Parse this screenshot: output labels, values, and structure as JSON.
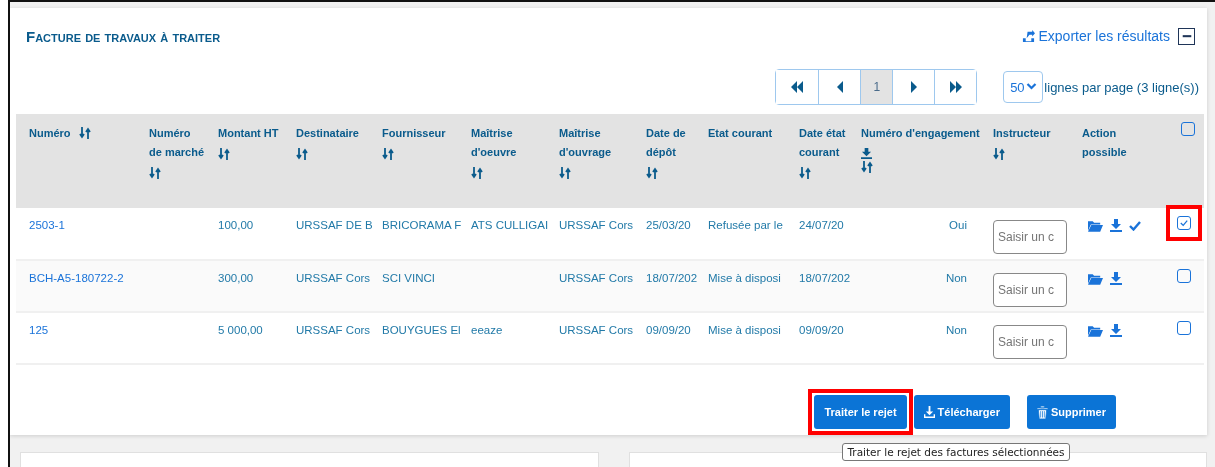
{
  "panel": {
    "title": "Facture de travaux à traiter",
    "export_label": "Exporter les résultats"
  },
  "pagination": {
    "pages": [
      {
        "kind": "first",
        "selected": false
      },
      {
        "kind": "prev",
        "selected": false
      },
      {
        "kind": "page",
        "label": "1",
        "selected": true
      },
      {
        "kind": "next",
        "selected": false
      },
      {
        "kind": "last",
        "selected": false
      }
    ],
    "page_size": "50",
    "page_size_label": "lignes par page (3 ligne(s))"
  },
  "table": {
    "columns": [
      {
        "label": "Numéro",
        "sortable": true,
        "download_icon": false
      },
      {
        "label": "Numéro de marché",
        "sortable": true,
        "download_icon": false
      },
      {
        "label": "Montant HT",
        "sortable": true,
        "download_icon": false
      },
      {
        "label": "Destinataire",
        "sortable": true,
        "download_icon": false
      },
      {
        "label": "Fournisseur",
        "sortable": true,
        "download_icon": false
      },
      {
        "label": "Maîtrise d'oeuvre",
        "sortable": true,
        "download_icon": false
      },
      {
        "label": "Maîtrise d'ouvrage",
        "sortable": true,
        "download_icon": false
      },
      {
        "label": "Date de dépôt",
        "sortable": true,
        "download_icon": false
      },
      {
        "label": "Etat courant",
        "sortable": false,
        "download_icon": false
      },
      {
        "label": "Date état courant",
        "sortable": true,
        "download_icon": false
      },
      {
        "label": "Numéro d'engagement",
        "sortable": true,
        "download_icon": true
      },
      {
        "label": "Instructeur",
        "sortable": true,
        "download_icon": false
      },
      {
        "label": "Action possible",
        "sortable": false,
        "download_icon": false
      }
    ],
    "all_checked": false,
    "rows": [
      {
        "cells": [
          "2503-1",
          "",
          "100,00",
          "URSSAF DE B",
          "BRICORAMA F",
          "ATS CULLIGAI",
          "URSSAF Cors",
          "25/03/20",
          "Refusée par le",
          "24/07/20",
          "Oui"
        ],
        "instructeur_placeholder": "Saisir un c",
        "actions": [
          {
            "kind": "folder"
          },
          {
            "kind": "download"
          },
          {
            "kind": "check"
          }
        ],
        "checked": true,
        "highlighted": true
      },
      {
        "cells": [
          "BCH-A5-180722-2",
          "",
          "300,00",
          "URSSAF Cors",
          "SCI VINCI",
          "",
          "URSSAF Cors",
          "18/07/202",
          "Mise à disposi",
          "18/07/202",
          "Non"
        ],
        "instructeur_placeholder": "Saisir un c",
        "actions": [
          {
            "kind": "folder"
          },
          {
            "kind": "download"
          }
        ],
        "checked": false,
        "highlighted": false
      },
      {
        "cells": [
          "125",
          "",
          "5 000,00",
          "URSSAF Cors",
          "BOUYGUES El",
          "eeaze",
          "URSSAF Cors",
          "09/09/20",
          "Mise à disposi",
          "09/09/20",
          "Non"
        ],
        "instructeur_placeholder": "Saisir un c",
        "actions": [
          {
            "kind": "folder"
          },
          {
            "kind": "download"
          }
        ],
        "checked": false,
        "highlighted": false
      }
    ]
  },
  "buttons": [
    {
      "kind": "reject",
      "label": "Traiter le rejet",
      "highlighted": true
    },
    {
      "kind": "download",
      "label": "Télécharger",
      "highlighted": false
    },
    {
      "kind": "delete",
      "label": "Supprimer",
      "highlighted": false
    }
  ],
  "tooltip": "Traiter le rejet des factures sélectionnées"
}
